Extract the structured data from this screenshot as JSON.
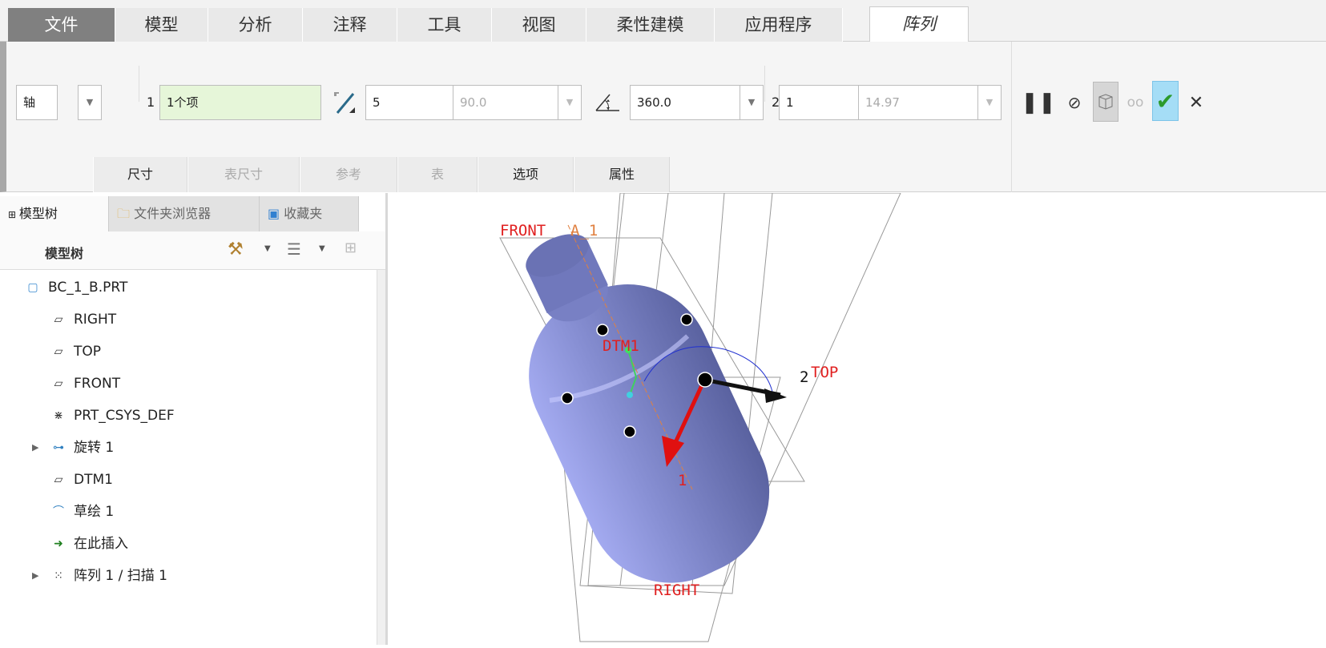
{
  "tabs": [
    {
      "label": "文件"
    },
    {
      "label": "模型"
    },
    {
      "label": "分析"
    },
    {
      "label": "注释"
    },
    {
      "label": "工具"
    },
    {
      "label": "视图"
    },
    {
      "label": "柔性建模"
    },
    {
      "label": "应用程序"
    },
    {
      "label": "阵列"
    }
  ],
  "ribbon": {
    "type_select": "轴",
    "dir1_num": "1",
    "dir1_value": "1个项",
    "count1": "5",
    "angle1": "90.0",
    "angle_extent": "360.0",
    "dir2_num": "2",
    "count2": "1",
    "spacing2": "14.97",
    "icons": [
      "pause-icon",
      "no-preview-icon",
      "geometry-preview-icon",
      "glasses-preview-icon",
      "confirm-icon",
      "cancel-icon"
    ],
    "subtabs": [
      {
        "label": "尺寸",
        "enabled": true
      },
      {
        "label": "表尺寸",
        "enabled": false
      },
      {
        "label": "参考",
        "enabled": false
      },
      {
        "label": "表",
        "enabled": false
      },
      {
        "label": "选项",
        "enabled": true
      },
      {
        "label": "属性",
        "enabled": true
      }
    ]
  },
  "panel": {
    "tabs": [
      {
        "label": "模型树"
      },
      {
        "label": "文件夹浏览器"
      },
      {
        "label": "收藏夹"
      }
    ],
    "title": "模型树",
    "items": [
      {
        "label": "BC_1_B.PRT",
        "icon": "part-icon"
      },
      {
        "label": "RIGHT",
        "icon": "datum-plane-icon"
      },
      {
        "label": "TOP",
        "icon": "datum-plane-icon"
      },
      {
        "label": "FRONT",
        "icon": "datum-plane-icon"
      },
      {
        "label": "PRT_CSYS_DEF",
        "icon": "csys-icon"
      },
      {
        "label": "旋转 1",
        "icon": "revolve-icon"
      },
      {
        "label": "DTM1",
        "icon": "datum-plane-icon"
      },
      {
        "label": "草绘 1",
        "icon": "sketch-icon"
      },
      {
        "label": "在此插入",
        "icon": "insert-arrow-icon"
      },
      {
        "label": "阵列 1 / 扫描 1",
        "icon": "pattern-icon"
      }
    ]
  },
  "viewport": {
    "labels": {
      "front": "FRONT",
      "axis": "A_1",
      "dtm": "DTM1",
      "top": "TOP",
      "right": "RIGHT",
      "dir2": "2",
      "dir1": "1"
    },
    "colors": {
      "model": "#8890d0",
      "label": "#e02020"
    }
  }
}
